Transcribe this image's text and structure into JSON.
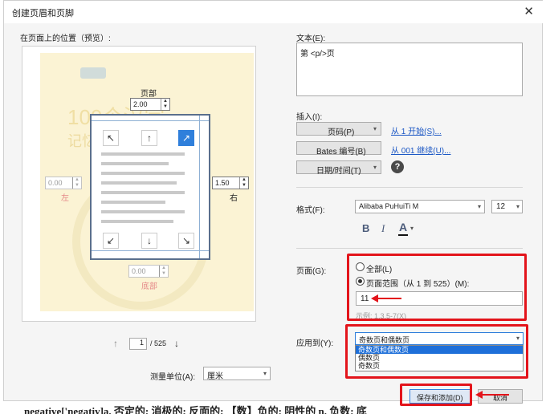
{
  "dialog": {
    "title": "创建页眉和页脚",
    "close": "✕"
  },
  "preview": {
    "label": "在页面上的位置（预览）:",
    "top_label": "页部",
    "top_value": "2.00",
    "left_value": "0.00",
    "left_label": "左",
    "right_value": "1.50",
    "right_label": "右",
    "bottom_value": "0.00",
    "bottom_label": "底部",
    "page_current": "1",
    "page_total": "/ 525",
    "unit_label": "测量单位(A):",
    "unit_value": "厘米",
    "bg_text_1": "100个汉字",
    "bg_text_2": "记忆 词"
  },
  "text": {
    "label": "文本(E):",
    "value": "第 <p/>页"
  },
  "insert": {
    "label": "插入(I):",
    "page_number_btn": "页码(P)",
    "page_number_link": "从 1 开始(S)...",
    "bates_btn": "Bates 编号(B)",
    "bates_link": "从 001 继续(U)...",
    "datetime_btn": "日期/时间(T)"
  },
  "format": {
    "label": "格式(F):",
    "font": "Alibaba PuHuiTi M",
    "size": "12",
    "bold": "B",
    "italic": "I",
    "color": "A"
  },
  "pages": {
    "label": "页面(G):",
    "all": "全部(L)",
    "range": "页面范围（从 1 到 525）(M):",
    "range_value": "11",
    "example": "示例: 1,3,5-7(X)"
  },
  "apply": {
    "label": "应用到(Y):",
    "selected": "奇数页和偶数页",
    "options": [
      "奇数页和偶数页",
      "偶数页",
      "奇数页"
    ]
  },
  "buttons": {
    "save_add": "保存和添加(D)",
    "cancel": "取消"
  },
  "background_text": "negative['negativ]a. 否定的; 消极的; 反面的; 【数】负的; 阴性的 n. 负数; 底"
}
